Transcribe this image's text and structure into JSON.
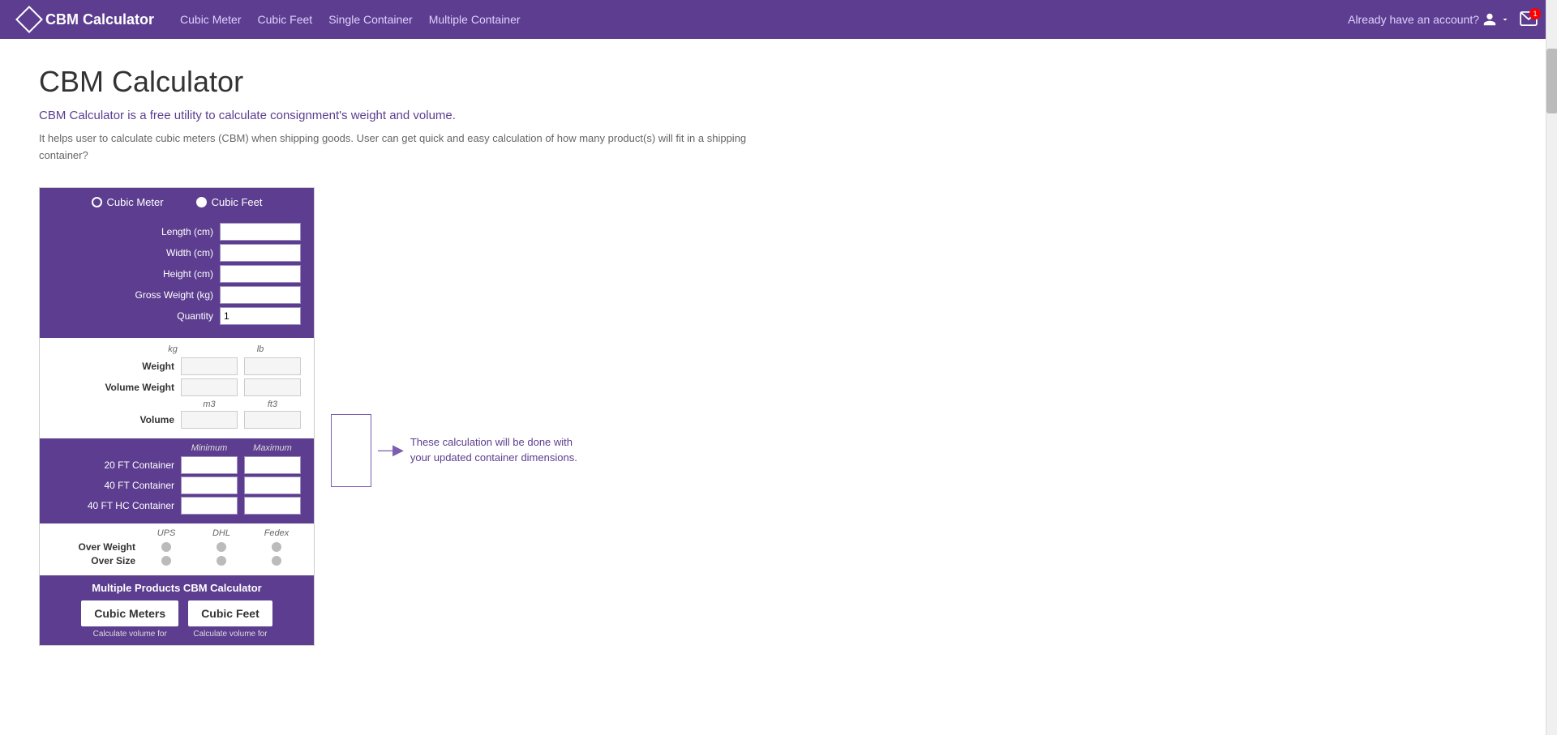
{
  "nav": {
    "brand": "CBM Calculator",
    "links": [
      "Cubic Meter",
      "Cubic Feet",
      "Single Container",
      "Multiple Container"
    ],
    "account_text": "Already have an account?",
    "mail_badge": "1"
  },
  "page": {
    "title": "CBM Calculator",
    "subtitle": "CBM Calculator is a free utility to calculate consignment's weight and volume.",
    "description": "It helps user to calculate cubic meters (CBM) when shipping goods. User can get quick and easy calculation of how many product(s) will fit in a shipping container?"
  },
  "calculator": {
    "unit_options": [
      "Cubic Meter",
      "Cubic Feet"
    ],
    "selected_unit": "Cubic Feet",
    "fields": [
      {
        "label": "Length (cm)",
        "value": ""
      },
      {
        "label": "Width (cm)",
        "value": ""
      },
      {
        "label": "Height (cm)",
        "value": ""
      },
      {
        "label": "Gross Weight (kg)",
        "value": ""
      },
      {
        "label": "Quantity",
        "value": "1"
      }
    ],
    "results": {
      "weight_labels": [
        "kg",
        "lb"
      ],
      "volume_labels": [
        "m3",
        "ft3"
      ],
      "rows": [
        {
          "label": "Weight",
          "values": [
            "",
            ""
          ]
        },
        {
          "label": "Volume Weight",
          "values": [
            "",
            ""
          ]
        },
        {
          "label": "Volume",
          "values": [
            "",
            ""
          ]
        }
      ]
    },
    "containers": {
      "headers": [
        "Minimum",
        "Maximum"
      ],
      "rows": [
        {
          "label": "20 FT Container",
          "min": "",
          "max": ""
        },
        {
          "label": "40 FT Container",
          "min": "",
          "max": ""
        },
        {
          "label": "40 FT HC Container",
          "min": "",
          "max": ""
        }
      ]
    },
    "couriers": {
      "headers": [
        "UPS",
        "DHL",
        "Fedex"
      ],
      "rows": [
        {
          "label": "Over Weight"
        },
        {
          "label": "Over Size"
        }
      ]
    },
    "multi_product": {
      "title": "Multiple Products CBM Calculator",
      "buttons": [
        "Cubic Meters",
        "Cubic Feet"
      ],
      "sub_texts": [
        "Calculate volume for",
        "Calculate volume for"
      ]
    },
    "callout_text": "These calculation will be done with your updated container dimensions."
  }
}
